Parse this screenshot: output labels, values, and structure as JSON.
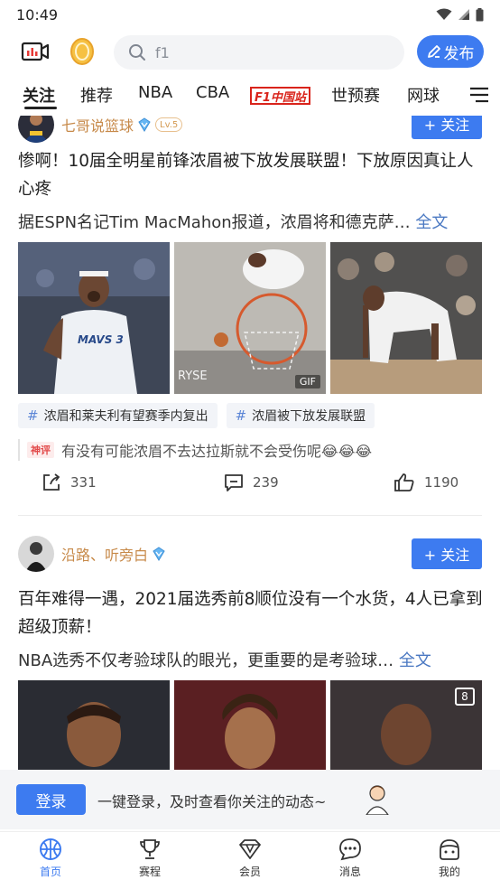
{
  "status_bar": {
    "time": "10:49"
  },
  "search": {
    "placeholder": "f1"
  },
  "publish": {
    "label": "发布"
  },
  "tabs": [
    {
      "label": "关注",
      "active": true
    },
    {
      "label": "推荐"
    },
    {
      "label": "NBA"
    },
    {
      "label": "CBA"
    },
    {
      "label": "F1中国站"
    },
    {
      "label": "世预赛"
    },
    {
      "label": "网球"
    }
  ],
  "posts": [
    {
      "author": "七哥说篮球",
      "level": "Lv.5",
      "follow_label": "+ 关注",
      "title": "惨啊！10届全明星前锋浓眉被下放发展联盟！下放原因真让人心疼",
      "summary": "据ESPN名记Tim MacMahon报道，浓眉将和德克萨…",
      "more": "全文",
      "gif_label": "GIF",
      "jersey_label": "MAVS 3",
      "jersey_number": "3",
      "topics": [
        "浓眉和莱夫利有望赛季内复出",
        "浓眉被下放发展联盟"
      ],
      "hot_tag": "神评",
      "hot_comment": "有没有可能浓眉不去达拉斯就不会受伤呢😂😂😂",
      "shares": "331",
      "comments": "239",
      "likes": "1190"
    },
    {
      "author": "沿路、听旁白",
      "follow_label": "+ 关注",
      "title": "百年难得一遇，2021届选秀前8顺位没有一个水货，4人已拿到超级顶薪！",
      "summary": "NBA选秀不仅考验球队的眼光，更重要的是考验球…",
      "more": "全文",
      "image_count": "8"
    }
  ],
  "login_banner": {
    "button": "登录",
    "text": "一键登录，及时查看你关注的动态~"
  },
  "bottom_nav": [
    {
      "label": "首页",
      "icon": "basketball-icon",
      "active": true
    },
    {
      "label": "赛程",
      "icon": "trophy-icon"
    },
    {
      "label": "会员",
      "icon": "diamond-icon"
    },
    {
      "label": "消息",
      "icon": "message-icon"
    },
    {
      "label": "我的",
      "icon": "profile-icon"
    }
  ],
  "colors": {
    "accent": "#3d7bf0",
    "author": "#c78a4a",
    "link": "#4a78c2"
  }
}
